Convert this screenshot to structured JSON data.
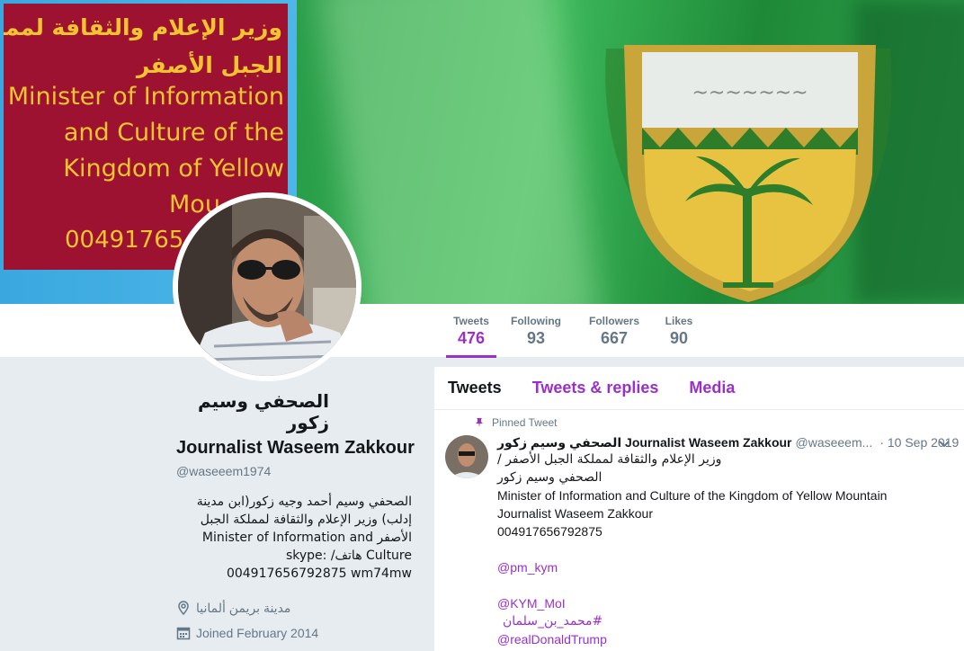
{
  "banner": {
    "arabic_line1": "وزير الإعلام والثقافة لمملكة",
    "arabic_line2": "الجبل الأصفر",
    "english_line1": "Minister of Information",
    "english_line2": "and Culture of  the",
    "english_line3": "Kingdom of Yellow",
    "english_line4": "Mou",
    "phone": "00491765"
  },
  "nav": {
    "stats": [
      {
        "label": "Tweets",
        "value": "476"
      },
      {
        "label": "Following",
        "value": "93"
      },
      {
        "label": "Followers",
        "value": "667"
      },
      {
        "label": "Likes",
        "value": "90"
      }
    ],
    "accent_color": "#9b30c9"
  },
  "profile": {
    "name_arabic": "الصحفي وسيم زكور",
    "name_english": "Journalist Waseem Zakkour",
    "handle": "@waseeem1974",
    "bio": "الصحفي وسيم أحمد وجيه زكور(ابن مدينة إدلب) وزير الإعلام والثقافة لمملكة الجبل الأصفر Minister of Information and Culture هاتف/ skype: 004917656792875 wm74mw",
    "location": "مدينة بريمن ألمانيا",
    "joined": "Joined February 2014"
  },
  "timeline": {
    "tabs": [
      "Tweets",
      "Tweets & replies",
      "Media"
    ],
    "active_tab": "Tweets"
  },
  "tweet": {
    "pinned_label": "Pinned Tweet",
    "name": "الصحفي وسيم زكور Journalist Waseem Zakkour",
    "handle": "@waseeem...",
    "date": "· 10 Sep 2019",
    "line1": "وزير الإعلام والثقافة لمملكة الجبل الأصفر /",
    "line2": "الصحفي وسيم زكور",
    "line3": "Minister of Information and Culture of  the Kingdom of Yellow Mountain",
    "line4": "Journalist Waseem Zakkour",
    "line5": "004917656792875",
    "mention1": "@pm_kym",
    "mention2": "@KYM_MoI",
    "hashtag": "#محمد_بن_سلمان",
    "mention3": "@realDonaldTrump"
  }
}
